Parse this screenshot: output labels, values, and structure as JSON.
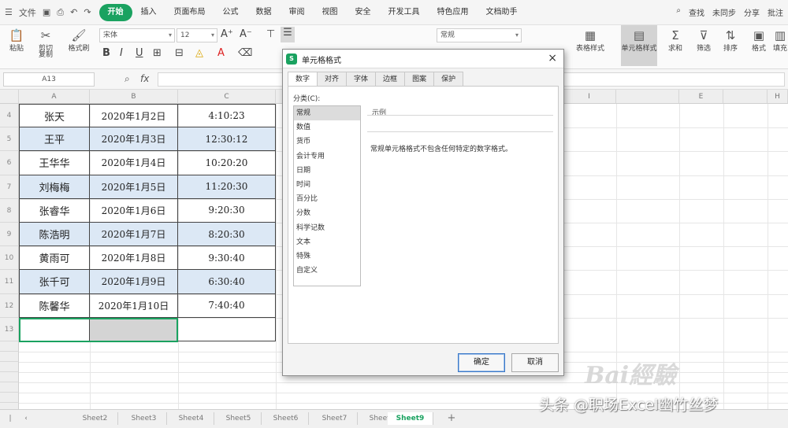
{
  "menubar": {
    "file": "文件",
    "tabs": [
      "开始",
      "插入",
      "页面布局",
      "公式",
      "数据",
      "审阅",
      "视图",
      "安全",
      "开发工具",
      "特色应用",
      "文档助手"
    ],
    "active_tab": "开始",
    "search": "查找",
    "sync": "未同步",
    "share": "分享",
    "batch": "批注"
  },
  "ribbon": {
    "cut": "剪切",
    "paste": "粘贴",
    "copy": "复制",
    "format_painter": "格式刷",
    "font": "宋体",
    "font_size": "12",
    "general": "常规",
    "table_style": "表格样式",
    "cell_style": "单元格样式",
    "sum": "求和",
    "filter": "筛选",
    "sort": "排序",
    "format": "格式",
    "fill": "填充"
  },
  "formulabar": {
    "namebox": "A13",
    "fx": "fx"
  },
  "grid": {
    "columns": [
      "A",
      "B",
      "C",
      "",
      "",
      "",
      "",
      "I",
      "",
      "E",
      "",
      "H"
    ],
    "rows": [
      {
        "num": "4",
        "name": "张天",
        "date": "2020年1月2日",
        "time": "4:10:23"
      },
      {
        "num": "5",
        "name": "王平",
        "date": "2020年1月3日",
        "time": "12:30:12"
      },
      {
        "num": "6",
        "name": "王华华",
        "date": "2020年1月4日",
        "time": "10:20:20"
      },
      {
        "num": "7",
        "name": "刘梅梅",
        "date": "2020年1月5日",
        "time": "11:20:30"
      },
      {
        "num": "8",
        "name": "张睿华",
        "date": "2020年1月6日",
        "time": "9:20:30"
      },
      {
        "num": "9",
        "name": "陈浩明",
        "date": "2020年1月7日",
        "time": "8:20:30"
      },
      {
        "num": "10",
        "name": "黄雨可",
        "date": "2020年1月8日",
        "time": "9:30:40"
      },
      {
        "num": "11",
        "name": "张千可",
        "date": "2020年1月9日",
        "time": "6:30:40"
      },
      {
        "num": "12",
        "name": "陈馨华",
        "date": "2020年1月10日",
        "time": "7:40:40"
      }
    ],
    "empty_row": "13"
  },
  "dialog": {
    "title": "单元格格式",
    "close": "×",
    "tabs": [
      "数字",
      "对齐",
      "字体",
      "边框",
      "图案",
      "保护"
    ],
    "active_tab": "数字",
    "category_label": "分类(C):",
    "categories": [
      "常规",
      "数值",
      "货币",
      "会计专用",
      "日期",
      "时间",
      "百分比",
      "分数",
      "科学记数",
      "文本",
      "特殊",
      "自定义"
    ],
    "selected_category": "常规",
    "sample_label": "示例",
    "description": "常规单元格格式不包含任何特定的数字格式。",
    "ok": "确定",
    "cancel": "取消"
  },
  "sheets": {
    "tabs": [
      "Sheet2",
      "Sheet3",
      "Sheet4",
      "Sheet5",
      "Sheet6",
      "Sheet7",
      "Sheet8",
      "Sheet9"
    ],
    "active": "Sheet9",
    "add": "+"
  },
  "watermark": {
    "text": "头条 @职场Excel幽竹丝梦",
    "baidu": "Bai經驗"
  }
}
